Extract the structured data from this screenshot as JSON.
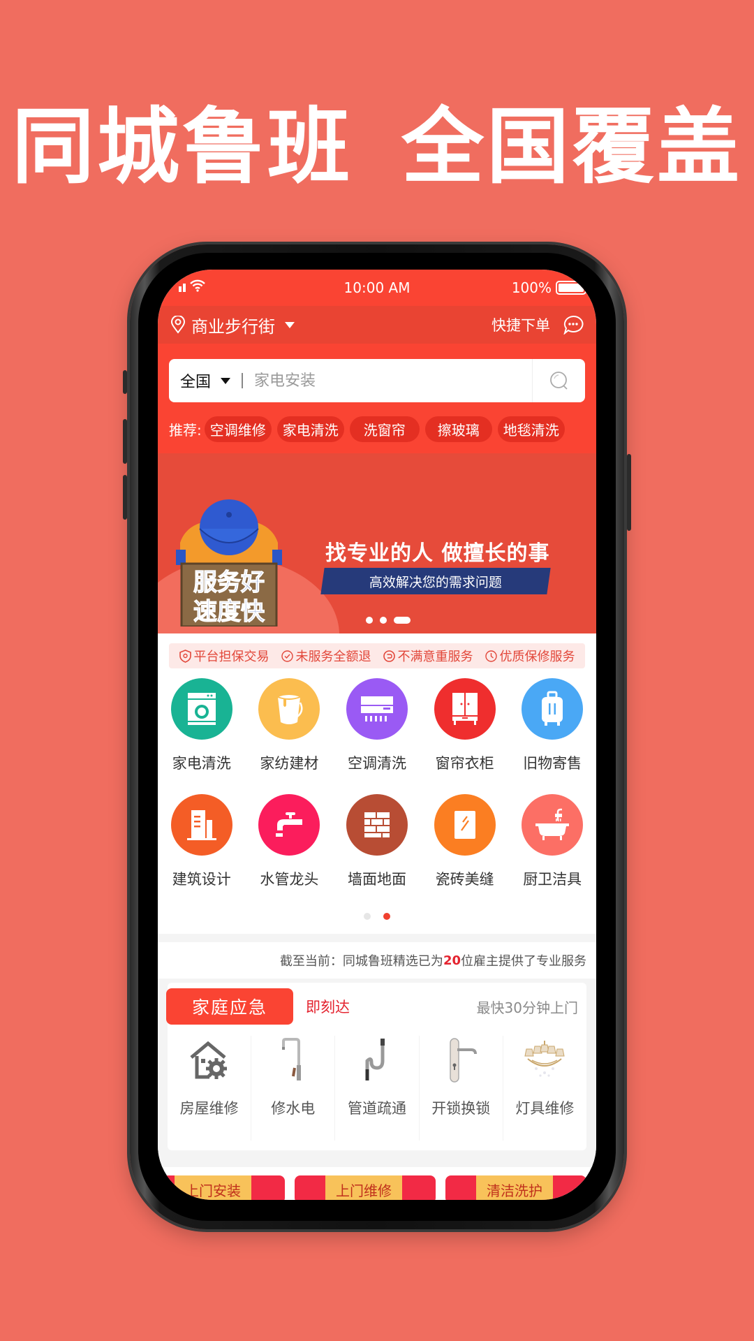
{
  "headline": {
    "left": "同城鲁班",
    "right": "全国覆盖"
  },
  "status_bar": {
    "time": "10:00 AM",
    "battery": "100%"
  },
  "app_bar": {
    "location": "商业步行街",
    "quick_order": "快捷下单"
  },
  "search": {
    "scope": "全国",
    "placeholder": "家电安装"
  },
  "recommend": {
    "label": "推荐:",
    "chips": [
      "空调维修",
      "家电清洗",
      "洗窗帘",
      "擦玻璃",
      "地毯清洗"
    ]
  },
  "banner": {
    "badge_line1": "服务好",
    "badge_line2": "速度快",
    "slogan": "找专业的人 做擅长的事",
    "subtitle": "高效解决您的需求问题",
    "slide_count": 3,
    "active_slide": 3
  },
  "guarantees": [
    {
      "icon": "shield-icon",
      "label": "平台担保交易"
    },
    {
      "icon": "check-circle-icon",
      "label": "未服务全额退"
    },
    {
      "icon": "redo-icon",
      "label": "不满意重服务"
    },
    {
      "icon": "clock-icon",
      "label": "优质保修服务"
    }
  ],
  "categories": [
    {
      "label": "家电清洗",
      "icon": "washing-machine-icon",
      "color": "#19b394"
    },
    {
      "label": "家纺建材",
      "icon": "paint-bucket-icon",
      "color": "#fbbd4f"
    },
    {
      "label": "空调清洗",
      "icon": "air-conditioner-icon",
      "color": "#9a5af4"
    },
    {
      "label": "窗帘衣柜",
      "icon": "wardrobe-icon",
      "color": "#ef2e2e"
    },
    {
      "label": "旧物寄售",
      "icon": "suitcase-icon",
      "color": "#4aa8f5"
    },
    {
      "label": "建筑设计",
      "icon": "building-icon",
      "color": "#f45d26"
    },
    {
      "label": "水管龙头",
      "icon": "faucet-icon",
      "color": "#fb1d5c"
    },
    {
      "label": "墙面地面",
      "icon": "brick-wall-icon",
      "color": "#b84d34"
    },
    {
      "label": "瓷砖美缝",
      "icon": "tile-icon",
      "color": "#fb7e22"
    },
    {
      "label": "厨卫洁具",
      "icon": "bathtub-icon",
      "color": "#fc6f65"
    }
  ],
  "category_pager": {
    "pages": 2,
    "active": 2
  },
  "stats": {
    "prefix": "截至当前：同城鲁班精选已为",
    "count": "20",
    "suffix": "位雇主提供了专业服务"
  },
  "emergency": {
    "tag": "家庭应急",
    "now": "即刻达",
    "fastest": "最快30分钟上门",
    "items": [
      {
        "label": "房屋维修",
        "icon": "house-gear-icon"
      },
      {
        "label": "修水电",
        "icon": "faucet-icon"
      },
      {
        "label": "管道疏通",
        "icon": "drain-pipe-icon"
      },
      {
        "label": "开锁换锁",
        "icon": "door-handle-icon"
      },
      {
        "label": "灯具维修",
        "icon": "chandelier-icon"
      }
    ]
  },
  "promos": [
    "上门安装",
    "上门维修",
    "清洁洗护"
  ]
}
